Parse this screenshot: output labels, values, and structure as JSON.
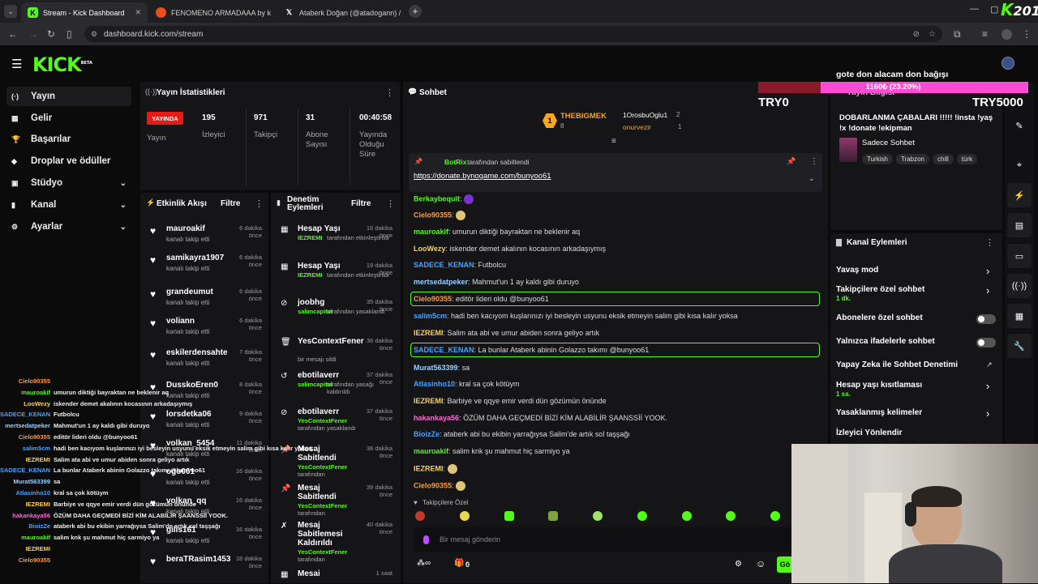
{
  "browser": {
    "tabs": [
      {
        "title": "Stream - Kick Dashboard"
      },
      {
        "title": "FENOMENO ARMADAAA by k"
      },
      {
        "title": "Ataberk Doğan (@atadogann) /"
      }
    ],
    "url": "dashboard.kick.com/stream",
    "corner_watermark": "201"
  },
  "kick": {
    "logo": "KICK",
    "beta": "BETA"
  },
  "nav": {
    "items": [
      {
        "label": "Yayın",
        "icon": "(·)"
      },
      {
        "label": "Gelir",
        "icon": "▦"
      },
      {
        "label": "Başarılar",
        "icon": "🏆"
      },
      {
        "label": "Droplar ve ödüller",
        "icon": "◆"
      },
      {
        "label": "Stüdyo",
        "icon": "▣",
        "chevron": "⌄"
      },
      {
        "label": "Kanal",
        "icon": "▮",
        "chevron": "⌄"
      },
      {
        "label": "Ayarlar",
        "icon": "⚙",
        "chevron": "⌄"
      }
    ]
  },
  "stats": {
    "title": "Yayın İstatistikleri",
    "live_badge": "YAYINDA",
    "live_label": "Yayın",
    "items": [
      {
        "value": "195",
        "label": "İzleyici"
      },
      {
        "value": "971",
        "label": "Takipçi"
      },
      {
        "value": "31",
        "label": "Abone Sayısı"
      },
      {
        "value": "00:40:58",
        "label": "Yayında Olduğu Süre"
      }
    ]
  },
  "activity": {
    "title": "Etkinlik Akışı",
    "filter": "Filtre",
    "events": [
      {
        "name": "mauroakif",
        "time": "6 dakika önce",
        "sub": "kanalı takip etti"
      },
      {
        "name": "samikayra1907",
        "time": "6 dakika önce",
        "sub": "kanalı takip etti"
      },
      {
        "name": "grandeumut",
        "time": "6 dakika önce",
        "sub": "kanalı takip etti"
      },
      {
        "name": "voliann",
        "time": "6 dakika önce",
        "sub": "kanalı takip etti"
      },
      {
        "name": "eskilerdensahte",
        "time": "7 dakika önce",
        "sub": "kanalı takip etti"
      },
      {
        "name": "DusskoEren0",
        "time": "8 dakika önce",
        "sub": "kanalı takip etti"
      },
      {
        "name": "lorsdetka06",
        "time": "9 dakika önce",
        "sub": "kanalı takip etti"
      },
      {
        "name": "volkan_5454",
        "time": "11 dakika önce",
        "sub": "kanalı takip etti"
      },
      {
        "name": "ogo061",
        "time": "16 dakika önce",
        "sub": "kanalı takip etti"
      },
      {
        "name": "volkan_qq",
        "time": "16 dakika önce",
        "sub": "kanalı takip etti"
      },
      {
        "name": "gilis161",
        "time": "16 dakika önce",
        "sub": "kanalı takip etti"
      },
      {
        "name": "beraTRasim1453",
        "time": "18 dakika önce",
        "sub": ""
      }
    ]
  },
  "moderation": {
    "title": "Denetim Eylemleri",
    "filter": "Filtre",
    "actions": [
      {
        "name": "Hesap Yaşı",
        "time": "16 dakika önce",
        "actor": "IEZREMI",
        "sub": "tarafından etkinleştirildi",
        "icon": "▦"
      },
      {
        "name": "Hesap Yaşı",
        "time": "19 dakika önce",
        "actor": "IEZREMI",
        "sub": "tarafından etkinleştirildi",
        "icon": "▦"
      },
      {
        "name": "joobhg",
        "time": "35 dakika önce",
        "actor": "salimcapital",
        "sub": "tarafından yasaklandı",
        "icon": "⊘"
      },
      {
        "name": "YesContextFener",
        "time": "36 dakika önce",
        "actor": "",
        "sub": "bir mesajı sildi",
        "icon": "🗑"
      },
      {
        "name": "ebotilaverr",
        "time": "37 dakika önce",
        "actor": "salimcapital",
        "sub": "tarafından yasağı kaldırıldı",
        "icon": "↺"
      },
      {
        "name": "ebotilaverr",
        "time": "37 dakika önce",
        "actor": "YesContextFener",
        "sub": "tarafından yasaklandı",
        "icon": "⊘"
      },
      {
        "name": "Mesaj Sabitlendi",
        "time": "38 dakika önce",
        "actor": "YesContextFener",
        "sub": "tarafından",
        "icon": "📌"
      },
      {
        "name": "Mesaj Sabitlendi",
        "time": "39 dakika önce",
        "actor": "YesContextFener",
        "sub": "tarafından",
        "icon": "📌"
      },
      {
        "name": "Mesaj Sabitlemesi Kaldırıldı",
        "time": "40 dakika önce",
        "actor": "YesContextFener",
        "sub": "tarafından",
        "icon": "✗"
      },
      {
        "name": "Mesai",
        "time": "1 saat",
        "actor": "",
        "sub": "",
        "icon": "▦"
      }
    ]
  },
  "chat": {
    "title": "Sohbet",
    "leaders": [
      {
        "name": "THEBIGMEK",
        "count": "8"
      },
      {
        "name": "1OrosbuOglu1",
        "count": "2"
      },
      {
        "name": "onurvezir",
        "count": "1"
      }
    ],
    "pinned": {
      "by": "BotRix",
      "label": "tarafından sabitlendi",
      "text": "https://donate.bynogame.com/bunyoo61"
    },
    "messages": [
      {
        "user": "Berkaybequit",
        "color": "#53fc18",
        "text": ""
      },
      {
        "user": "Cielo90355",
        "color": "#ff9a3c",
        "text": ""
      },
      {
        "user": "mauroakif",
        "color": "#53fc18",
        "text": "umurun diktiği bayraktan ne beklenir aq"
      },
      {
        "user": "LooWezy",
        "color": "#ffd24a",
        "text": "iskender demet akalının kocasının arkadaşıymış"
      },
      {
        "user": "SADECE_KENAN",
        "color": "#4aa3ff",
        "text": "Futbolcu"
      },
      {
        "user": "mertsedatpeker",
        "color": "#9ad0ff",
        "text": "Mahmut'un 1 ay kaldı gibi duruyo"
      },
      {
        "user": "Cielo90355",
        "color": "#ff9a3c",
        "text": "editör lideri oldu @bunyoo61"
      },
      {
        "user": "salim5cm",
        "color": "#4aa3ff",
        "text": "hadi ben kacıyom kuşlarınızı iyi besleyin usyunu eksik etmeyin salim gibi kısa kalır yoksa"
      },
      {
        "user": "IEZREMI",
        "color": "#ffd24a",
        "text": "Salim ata abi ve umur abiden sonra geliyo artık"
      },
      {
        "user": "SADECE_KENAN",
        "color": "#4aa3ff",
        "text": "La bunlar Ataberk abinin Golazzo takımı @bunyoo61"
      },
      {
        "user": "Murat563399",
        "color": "#9ad0ff",
        "text": "sa"
      },
      {
        "user": "Atlasinho10",
        "color": "#4aa3ff",
        "text": "kral sa çok kötüym"
      },
      {
        "user": "IEZREMI",
        "color": "#ffd24a",
        "text": "Barbiye ve qqye emir verdi dün gözümün önünde"
      },
      {
        "user": "hakankaya56",
        "color": "#ff6ad5",
        "text": "ÖZÜM DAHA GEÇMEDİ BİZİ KİM ALABİLİR ŞAANSSİİ YOOK."
      },
      {
        "user": "BioizZe",
        "color": "#4aa3ff",
        "text": "ataberk abi bu ekibin yarrağıysa Salim'de artık sol taşşağı"
      },
      {
        "user": "mauroakif",
        "color": "#53fc18",
        "text": "salim knk şu mahmut hiç sarmiyo ya"
      },
      {
        "user": "IEZREMI",
        "color": "#ffd24a",
        "text": ""
      },
      {
        "user": "Cielo90355",
        "color": "#ff9a3c",
        "text": ""
      }
    ],
    "followers_only": "Takipçilere Özel",
    "input_placeholder": "Bir mesaj gönderin",
    "points": "0",
    "send_label": "Gö"
  },
  "overlay": {
    "donation_title": "gote don alacam don bağışı",
    "progress_text": "1160₺ (23.20%)",
    "progress": 0.232,
    "left_amount": "TRY0",
    "right_amount": "TRY5000",
    "chat": [
      {
        "user": "Cielo90355",
        "color": "#ff9a3c",
        "text": ""
      },
      {
        "user": "mauroakif",
        "color": "#53fc18",
        "text": "umurun diktiği bayraktan ne beklenir aq"
      },
      {
        "user": "LooWezy",
        "color": "#ffd24a",
        "text": "iskender demet akalının kocasının arkadaşıymış"
      },
      {
        "user": "SADECE_KENAN",
        "color": "#4aa3ff",
        "text": "Futbolcu"
      },
      {
        "user": "mertsedatpeker",
        "color": "#9ad0ff",
        "text": "Mahmut'un 1 ay kaldı gibi duruyo"
      },
      {
        "user": "Cielo90355",
        "color": "#ff9a3c",
        "text": "editör lideri oldu @bunyoo61"
      },
      {
        "user": "salim5cm",
        "color": "#4aa3ff",
        "text": "hadi ben kacıyom kuşlarınızı iyi besleyin usyunu eksik etmeyin salim gibi kısa kalır yoksa"
      },
      {
        "user": "IEZREMI",
        "color": "#ffd24a",
        "text": "Salim ata abi ve umur abiden sonra geliyo artık"
      },
      {
        "user": "SADECE_KENAN",
        "color": "#4aa3ff",
        "text": "La bunlar Ataberk abinin Golazzo takımı @bunyoo61"
      },
      {
        "user": "Murat563399",
        "color": "#9ad0ff",
        "text": "sa"
      },
      {
        "user": "Atlasinho10",
        "color": "#4aa3ff",
        "text": "kral sa çok kötüym"
      },
      {
        "user": "IEZREMI",
        "color": "#ffd24a",
        "text": "Barbiye ve qqye emir verdi dün gözümün önünde"
      },
      {
        "user": "hakankaya56",
        "color": "#ff6ad5",
        "text": "ÖZÜM DAHA GEÇMEDİ BİZİ KİM ALABİLİR ŞAANSSİİ YOOK."
      },
      {
        "user": "BioizZe",
        "color": "#4aa3ff",
        "text": "ataberk abi bu ekibin yarrağıysa Salim'de artık sol taşşağı"
      },
      {
        "user": "mauroakif",
        "color": "#53fc18",
        "text": "salim knk şu mahmut hiç sarmiyo ya"
      },
      {
        "user": "IEZREMI",
        "color": "#ffd24a",
        "text": ""
      },
      {
        "user": "Cielo90355",
        "color": "#ff9a3c",
        "text": ""
      }
    ]
  },
  "stream_info": {
    "title": "Yayın Bilgisi",
    "stream_title": "DOBARLANMA ÇABALARI !!!!! !insta !yaş !x !donate !ekipman",
    "category": "Sadece Sohbet",
    "tags": [
      "Turkish",
      "Trabzon",
      "chill",
      "türk"
    ]
  },
  "channel_actions": {
    "title": "Kanal Eylemleri",
    "items": [
      {
        "label": "Yavaş mod",
        "sub": "",
        "control": "chevron"
      },
      {
        "label": "Takipçilere özel sohbet",
        "sub": "1 dk.",
        "control": "chevron"
      },
      {
        "label": "Abonelere özel sohbet",
        "sub": "",
        "control": "toggle"
      },
      {
        "label": "Yalnızca ifadelerle sohbet",
        "sub": "",
        "control": "toggle"
      },
      {
        "label": "Yapay Zeka ile Sohbet Denetimi",
        "sub": "",
        "control": "external"
      },
      {
        "label": "Hesap yaşı kısıtlaması",
        "sub": "1 sa.",
        "control": "chevron"
      },
      {
        "label": "Yasaklanmış kelimeler",
        "sub": "",
        "control": "chevron"
      },
      {
        "label": "İzleyici Yönlendir",
        "sub": "",
        "control": "none"
      }
    ]
  },
  "colors": {
    "accent": "#53fc18",
    "panel": "#151517",
    "bg": "#0b0b0b",
    "live": "#e91916"
  }
}
